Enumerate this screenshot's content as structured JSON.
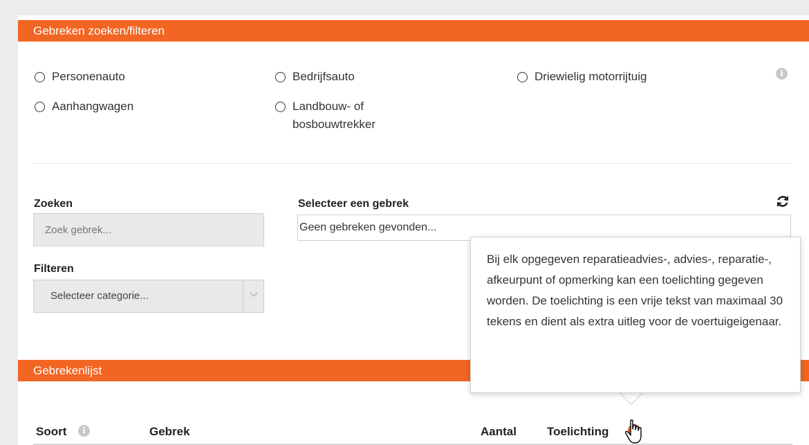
{
  "filter_section": {
    "title": "Gebreken zoeken/filteren",
    "vehicle_types": [
      "Personenauto",
      "Bedrijfsauto",
      "Driewielig motorrijtuig",
      "Aanhangwagen",
      "Landbouw- of",
      "bosbouwtrekker"
    ],
    "search_label": "Zoeken",
    "search_placeholder": "Zoek gebrek...",
    "filter_label": "Filteren",
    "category_select_value": "Selecteer categorie...",
    "defect_select_label": "Selecteer een gebrek",
    "defect_select_value": "Geen gebreken gevonden..."
  },
  "list_section": {
    "title": "Gebrekenlijst",
    "columns": {
      "type": "Soort",
      "defect": "Gebrek",
      "count": "Aantal",
      "explanation": "Toelichting"
    }
  },
  "tooltip": {
    "text": "Bij elk opgegeven reparatieadvies-, advies-, reparatie-, afkeurpunt of opmerking kan een toelichting gegeven worden. De toelichting is een vrije tekst van maximaal 30 tekens en dient als extra uitleg voor de voertuigeigenaar."
  },
  "icons": {
    "info": "info-icon",
    "refresh": "refresh-icon",
    "dropdown": "chevron-down-icon",
    "cursor": "hand-pointer-icon"
  },
  "colors": {
    "accent": "#f26522",
    "info_gray": "#c8c8c8"
  }
}
